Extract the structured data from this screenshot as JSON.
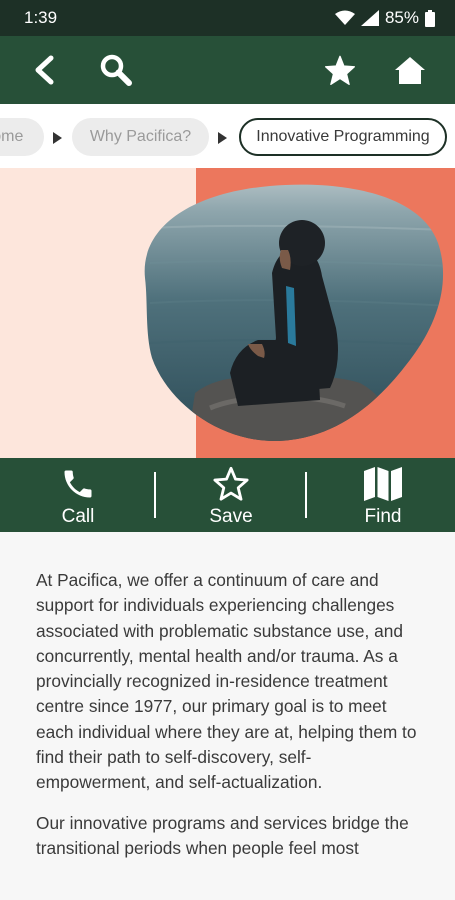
{
  "status_bar": {
    "time": "1:39",
    "battery": "85%",
    "icons": [
      "wifi-icon",
      "signal-icon",
      "battery-icon"
    ]
  },
  "app_bar": {
    "icons": [
      "back-icon",
      "search-icon",
      "star-icon",
      "home-icon"
    ]
  },
  "breadcrumb": {
    "items": [
      "Home",
      "Why Pacifica?",
      "Innovative Programming"
    ],
    "active_index": 2
  },
  "hero": {
    "image_description": "hero-photo"
  },
  "actions": [
    {
      "label": "Call",
      "icon": "phone-icon"
    },
    {
      "label": "Save",
      "icon": "star-outline-icon"
    },
    {
      "label": "Find",
      "icon": "map-icon"
    }
  ],
  "content": {
    "paragraphs": [
      "At Pacifica, we offer a continuum of care and support for individuals experiencing challenges associated with problematic substance use, and concurrently, mental health and/or trauma. As a provincially recognized in-residence treatment centre since 1977, our primary goal is to meet each individual where they are at, helping them to find their path to self-discovery, self-empowerment, and self-actualization.",
      "Our innovative programs and services bridge the transitional periods when people feel most"
    ]
  },
  "colors": {
    "status_bar": "#1d3026",
    "primary_green": "#275038",
    "hero_peach": "#fde6dc",
    "hero_coral": "#ec775d",
    "body_text": "#3a3a3a"
  }
}
